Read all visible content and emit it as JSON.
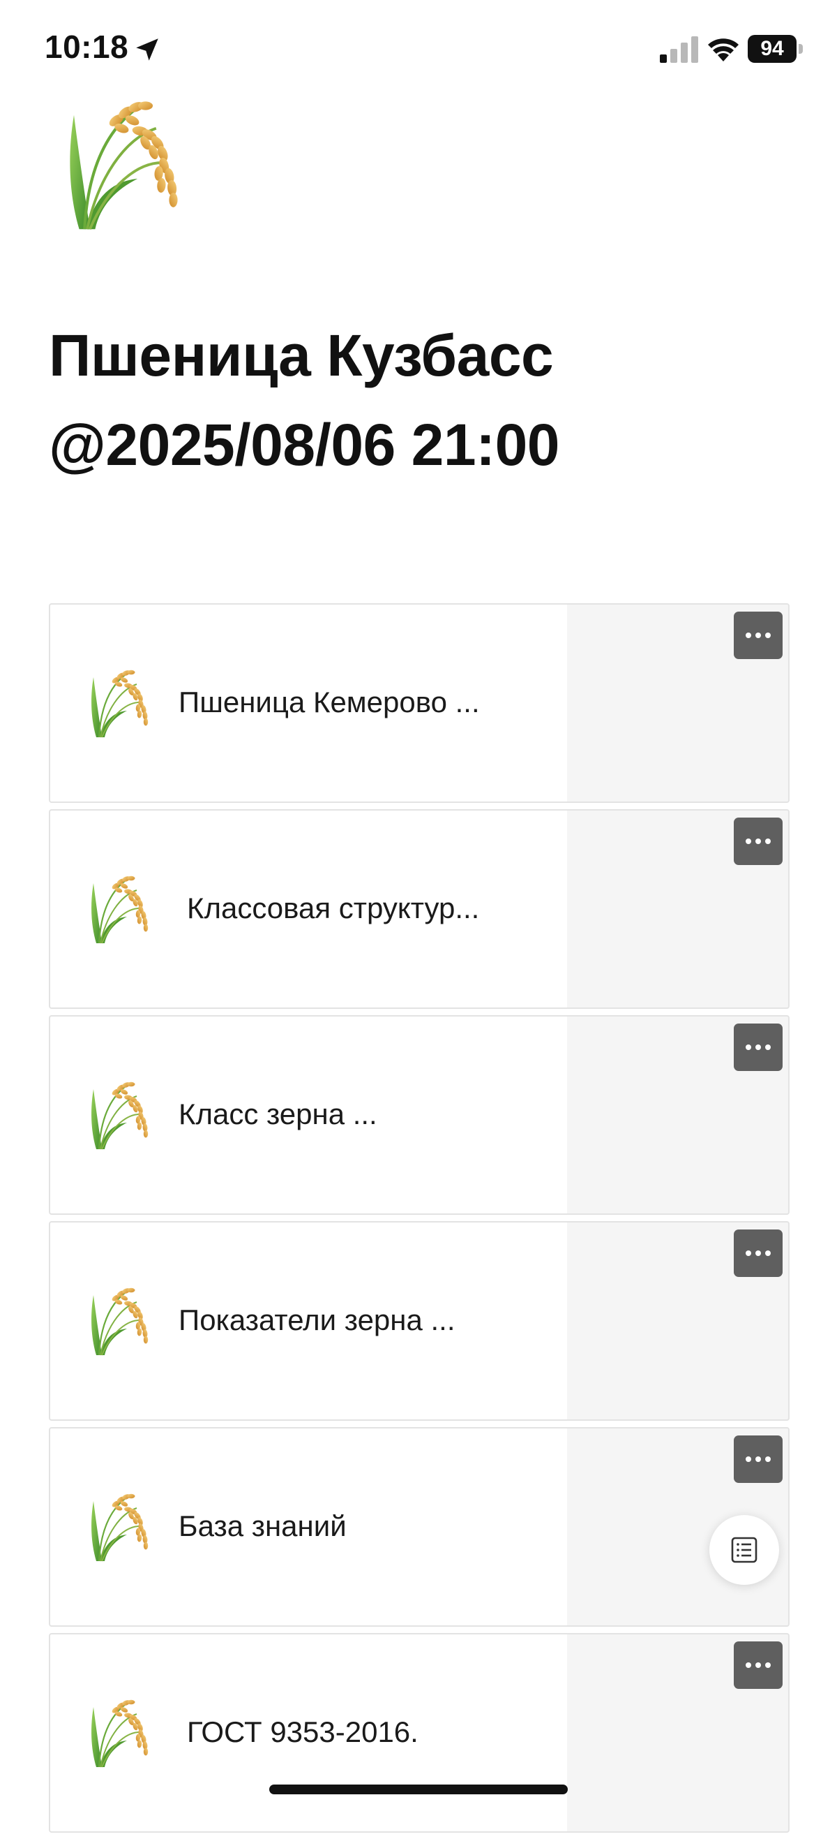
{
  "status_bar": {
    "time": "10:18",
    "battery": "94",
    "icons": [
      "location-arrow-icon",
      "cellular-signal-icon",
      "wifi-icon",
      "battery-icon"
    ]
  },
  "page": {
    "icon": "wheat-sheaf-icon",
    "title_line1": "Пшеница Кузбасс",
    "title_line2": "@2025/08/06 21:00"
  },
  "cards": [
    {
      "label": "Пшеница Кемерово  ...",
      "icon": "wheat-sheaf-icon",
      "more_icon": "more-dots-icon"
    },
    {
      "label": "Классовая структур...",
      "icon": "wheat-sheaf-icon",
      "more_icon": "more-dots-icon"
    },
    {
      "label": "Класс зерна  ...",
      "icon": "wheat-sheaf-icon",
      "more_icon": "more-dots-icon"
    },
    {
      "label": "Показатели зерна ...",
      "icon": "wheat-sheaf-icon",
      "more_icon": "more-dots-icon"
    },
    {
      "label": "База знаний",
      "icon": "wheat-sheaf-icon",
      "more_icon": "more-dots-icon"
    },
    {
      "label": "ГОСТ 9353-2016.",
      "icon": "wheat-sheaf-icon",
      "more_icon": "more-dots-icon"
    }
  ],
  "floating_button": {
    "icon": "table-of-contents-icon"
  },
  "colors": {
    "card_border": "#e3e3e3",
    "card_right_panel": "#f5f5f5",
    "more_button": "#5f5f5f",
    "wheat_grain": "#e0a640",
    "wheat_stem": "#5aa834"
  }
}
